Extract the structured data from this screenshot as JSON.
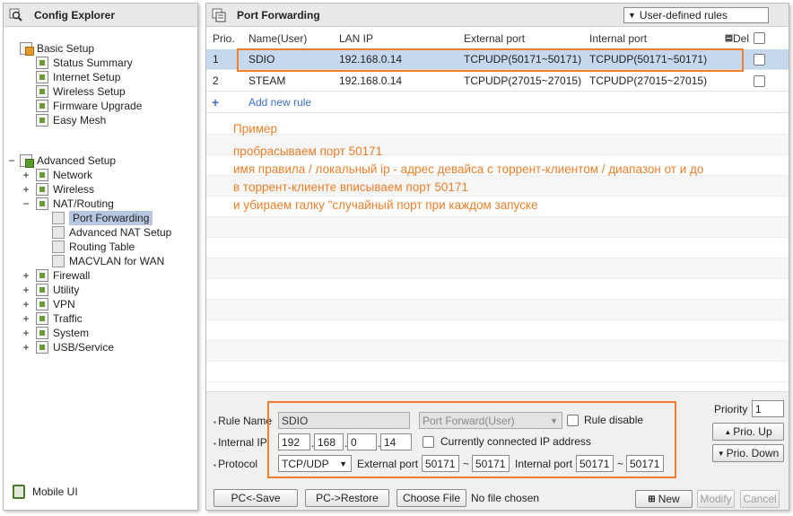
{
  "explorer": {
    "title": "Config Explorer",
    "basic_setup": "Basic Setup",
    "basic_items": [
      "Status Summary",
      "Internet Setup",
      "Wireless Setup",
      "Firmware Upgrade",
      "Easy Mesh"
    ],
    "advanced_setup": "Advanced Setup",
    "advanced_items": {
      "network": "Network",
      "wireless": "Wireless",
      "nat_routing": "NAT/Routing",
      "nat_children": [
        "Port Forwarding",
        "Advanced NAT Setup",
        "Routing Table",
        "MACVLAN for WAN"
      ],
      "firewall": "Firewall",
      "utility": "Utility",
      "vpn": "VPN",
      "traffic": "Traffic",
      "system": "System",
      "usb_service": "USB/Service"
    },
    "mobile_ui": "Mobile UI"
  },
  "port_forwarding": {
    "title": "Port Forwarding",
    "filter_selected": "User-defined rules",
    "columns": {
      "prio": "Prio.",
      "name": "Name(User)",
      "lan_ip": "LAN IP",
      "external_port": "External port",
      "internal_port": "Internal port",
      "del": "Del"
    },
    "rules": [
      {
        "prio": "1",
        "name": "SDIO",
        "lan_ip": "192.168.0.14",
        "external_port": "TCPUDP(50171~50171)",
        "internal_port": "TCPUDP(50171~50171)"
      },
      {
        "prio": "2",
        "name": "STEAM",
        "lan_ip": "192.168.0.14",
        "external_port": "TCPUDP(27015~27015)",
        "internal_port": "TCPUDP(27015~27015)"
      }
    ],
    "add_new_rule": "Add new rule"
  },
  "annotation": {
    "lines": [
      "Пример",
      "пробрасываем порт 50171",
      "имя правила / локальный ip - адрес девайса с торрент-клиентом / диапазон от и до",
      "в торрент-клиенте вписываем порт 50171",
      "и убираем галку \"случайный порт при каждом запуске"
    ]
  },
  "form": {
    "rule_name_label": "Rule Name",
    "rule_name_value": "SDIO",
    "rule_type": "Port Forward(User)",
    "rule_disable": "Rule disable",
    "internal_ip_label": "Internal IP",
    "ip": [
      "192",
      "168",
      "0",
      "14"
    ],
    "currently_connected": "Currently connected IP address",
    "protocol_label": "Protocol",
    "protocol_value": "TCP/UDP",
    "external_port_label": "External port",
    "ext_from": "50171",
    "ext_to": "50171",
    "internal_port_label": "Internal port",
    "int_from": "50171",
    "int_to": "50171",
    "tilde": "~",
    "priority_label": "Priority",
    "priority_value": "1",
    "prio_up": "Prio. Up",
    "prio_down": "Prio. Down"
  },
  "buttons": {
    "pc_save": "PC<-Save",
    "pc_restore": "PC->Restore",
    "choose_file": "Choose File",
    "no_file": "No file chosen",
    "new": "New",
    "modify": "Modify",
    "cancel": "Cancel"
  }
}
